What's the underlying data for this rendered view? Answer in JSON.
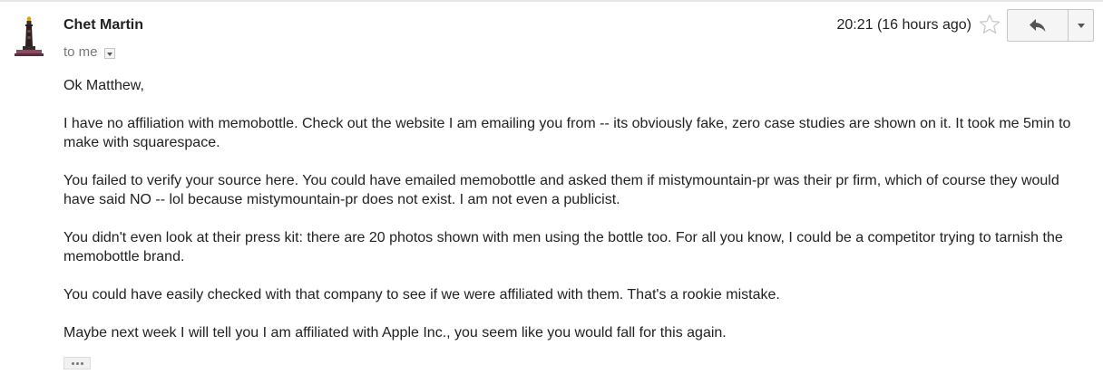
{
  "message": {
    "sender_name": "Chet Martin",
    "recipient_line": "to me",
    "timestamp": "20:21 (16 hours ago)",
    "body_paragraphs": [
      "Ok Matthew,",
      "I have no affiliation with memobottle. Check out the website I am emailing you from -- its obviously fake, zero case studies are shown on it. It took me 5min to make with squarespace.",
      "You failed to verify your source here. You could have emailed memobottle and asked them if mistymountain-pr was their pr firm, which of course they would have said NO -- lol because mistymountain-pr does not exist. I am not even a publicist.",
      "You didn't even look at their press kit: there are 20 photos shown with men using the bottle too. For all you know, I could be a competitor trying to tarnish the memobottle brand.",
      "You could have easily checked with that company to see if we were affiliated with them. That's a rookie mistake.",
      "Maybe next week I will tell you I am affiliated with Apple Inc., you seem like you would fall for this again."
    ]
  },
  "icons": {
    "avatar": "lighthouse-avatar",
    "star": "star-outline-icon",
    "reply": "reply-arrow-icon",
    "more": "chevron-down-icon",
    "details": "details-caret-icon",
    "trimmed": "show-trimmed-content-icon"
  },
  "colors": {
    "text": "#222222",
    "secondary_text": "#777777",
    "button_bg": "#f5f5f5",
    "button_border": "#c6c6c6"
  }
}
